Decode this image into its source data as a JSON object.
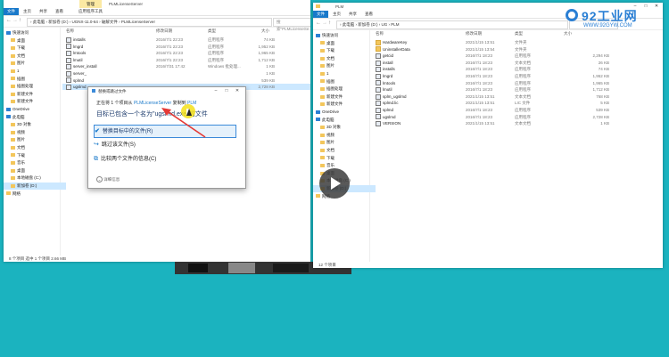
{
  "left_window": {
    "title_tab_manage": "管理",
    "title_path": "PLMLicenseServer",
    "ribbon_tabs": [
      "文件",
      "主页",
      "共享",
      "查看",
      "应用程序工具"
    ],
    "breadcrumb": "› 此电脑 › 新加卷 (D:) › UGNX-11.0-64 › 破解文件 › PLMLicenseServer",
    "search_placeholder": "搜索\"PLMLicenseSe...\"",
    "columns": {
      "name": "名称",
      "date": "修改日期",
      "type": "类型",
      "size": "大小"
    },
    "nav": [
      {
        "label": "快速访问"
      },
      {
        "label": "桌面"
      },
      {
        "label": "下载"
      },
      {
        "label": "文档"
      },
      {
        "label": "图片"
      },
      {
        "label": "1"
      },
      {
        "label": "插图"
      },
      {
        "label": "插图处理"
      },
      {
        "label": "新建文件"
      },
      {
        "label": "新建文件"
      },
      {
        "label": "OneDrive"
      },
      {
        "label": "此电脑"
      },
      {
        "label": "3D 对象"
      },
      {
        "label": "视频"
      },
      {
        "label": "图片"
      },
      {
        "label": "文档"
      },
      {
        "label": "下载"
      },
      {
        "label": "音乐"
      },
      {
        "label": "桌面"
      },
      {
        "label": "本地磁盘 (C:)"
      },
      {
        "label": "新加卷 (D:)"
      },
      {
        "label": "网络"
      }
    ],
    "files": [
      {
        "name": "installs",
        "date": "2016/7/1 22:23",
        "type": "应用程序",
        "size": "74 KB"
      },
      {
        "name": "lmgrd",
        "date": "2016/7/1 22:23",
        "type": "应用程序",
        "size": "1,952 KB"
      },
      {
        "name": "lmtools",
        "date": "2016/7/1 22:23",
        "type": "应用程序",
        "size": "1,965 KB"
      },
      {
        "name": "lmutil",
        "date": "2016/7/1 22:23",
        "type": "应用程序",
        "size": "1,712 KB"
      },
      {
        "name": "server_install",
        "date": "2016/7/31 17:42",
        "type": "Windows 批处理...",
        "size": "1 KB"
      },
      {
        "name": "server_",
        "date": "",
        "type": "",
        "size": "1 KB"
      },
      {
        "name": "splmd",
        "date": "",
        "type": "",
        "size": "539 KB"
      },
      {
        "name": "ugslmd",
        "date": "",
        "type": "",
        "size": "2,728 KB"
      }
    ],
    "status": "8 个项目    选中 1 个项目  2.66 MB"
  },
  "dialog": {
    "title": "替换或跳过文件",
    "progress_line_prefix": "正在将 1 个项目从",
    "progress_src": "PLMLicenseServer",
    "progress_mid": "复制到",
    "progress_dst": "PLM",
    "conflict_message": "目标已包含一个名为\"ugslmd.exe\"的文件",
    "option_replace": "替换目标中的文件(R)",
    "option_skip": "跳过该文件(S)",
    "option_compare": "比较两个文件的信息(C)",
    "details_label": "详细信息"
  },
  "right_window": {
    "title_path": "PLM",
    "ribbon_tabs": [
      "文件",
      "主页",
      "共享",
      "查看"
    ],
    "breadcrumb": "› 此电脑 › 新加卷 (D:) › UG › PLM",
    "columns": {
      "name": "名称",
      "date": "修改日期",
      "type": "类型",
      "size": "大小"
    },
    "nav": [
      {
        "label": "快速访问"
      },
      {
        "label": "桌面"
      },
      {
        "label": "下载"
      },
      {
        "label": "文档"
      },
      {
        "label": "图片"
      },
      {
        "label": "1"
      },
      {
        "label": "插图"
      },
      {
        "label": "插图处理"
      },
      {
        "label": "新建文件"
      },
      {
        "label": "新建文件"
      },
      {
        "label": "OneDrive"
      },
      {
        "label": "此电脑"
      },
      {
        "label": "3D 对象"
      },
      {
        "label": "视频"
      },
      {
        "label": "图片"
      },
      {
        "label": "文档"
      },
      {
        "label": "下载"
      },
      {
        "label": "音乐"
      },
      {
        "label": "桌面"
      },
      {
        "label": "本地磁盘 (C:)"
      },
      {
        "label": "新加卷 (D:)"
      },
      {
        "label": "网络"
      }
    ],
    "files": [
      {
        "name": "HardwareKey",
        "date": "2021/1/15 13:51",
        "type": "文件夹",
        "size": "",
        "folder": true
      },
      {
        "name": "UninstallerData",
        "date": "2021/1/15 13:54",
        "type": "文件夹",
        "size": "",
        "folder": true
      },
      {
        "name": "getcid",
        "date": "2016/7/1 18:23",
        "type": "应用程序",
        "size": "2,294 KB"
      },
      {
        "name": "install",
        "date": "2016/7/1 18:23",
        "type": "文本文档",
        "size": "26 KB"
      },
      {
        "name": "installs",
        "date": "2016/7/1 18:23",
        "type": "应用程序",
        "size": "74 KB"
      },
      {
        "name": "lmgrd",
        "date": "2016/7/1 18:23",
        "type": "应用程序",
        "size": "1,952 KB"
      },
      {
        "name": "lmtools",
        "date": "2016/7/1 18:23",
        "type": "应用程序",
        "size": "1,965 KB"
      },
      {
        "name": "lmutil",
        "date": "2016/7/1 18:23",
        "type": "应用程序",
        "size": "1,712 KB"
      },
      {
        "name": "splm_ugslmd",
        "date": "2021/1/15 13:51",
        "type": "文本文档",
        "size": "768 KB"
      },
      {
        "name": "splmd.lic",
        "date": "2021/1/15 13:51",
        "type": "LIC 文件",
        "size": "5 KB"
      },
      {
        "name": "splmd",
        "date": "2016/7/1 18:23",
        "type": "应用程序",
        "size": "539 KB"
      },
      {
        "name": "ugslmd",
        "date": "2016/7/1 18:23",
        "type": "应用程序",
        "size": "2,728 KB"
      },
      {
        "name": "VERSION",
        "date": "2021/1/15 13:51",
        "type": "文本文档",
        "size": "1 KB"
      }
    ],
    "status": "12 个项目"
  },
  "watermark": {
    "brand": "92工业网",
    "url": "WWW.92GYW.COM"
  },
  "colors": {
    "accent": "#1979ca",
    "desktop": "#1bb3bf",
    "selection": "#cce8ff",
    "cursor": "#f5e11a",
    "arrow": "#e53935"
  }
}
